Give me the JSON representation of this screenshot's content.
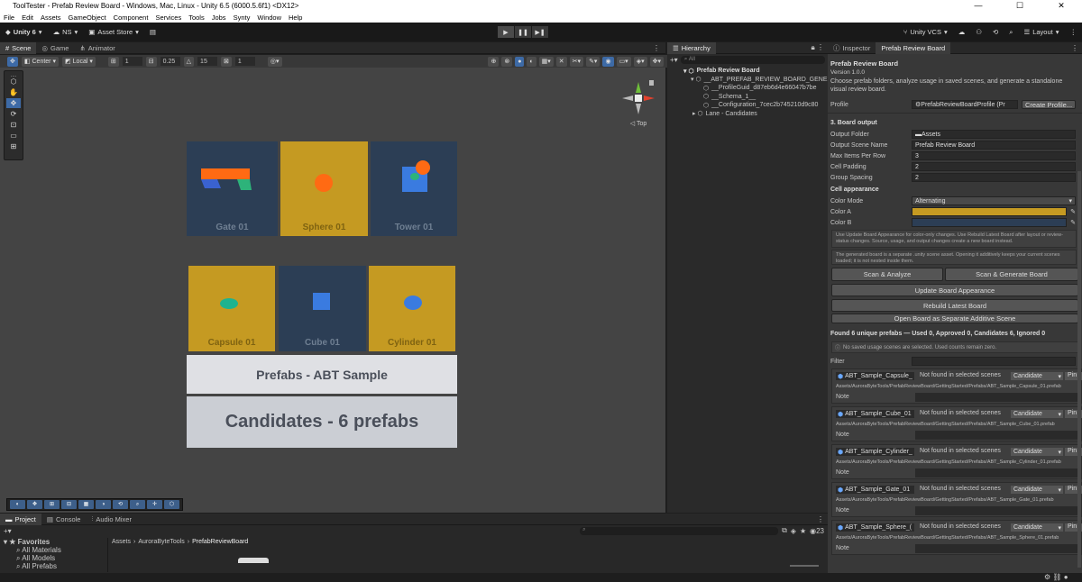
{
  "window": {
    "title": "ToolTester - Prefab Review Board - Windows, Mac, Linux - Unity 6.5 (6000.5.6f1) <DX12>"
  },
  "menu": [
    "File",
    "Edit",
    "Assets",
    "GameObject",
    "Component",
    "Services",
    "Tools",
    "Jobs",
    "Synty",
    "Window",
    "Help"
  ],
  "toolbar": {
    "account": "Unity 6",
    "ns": "NS",
    "asset_store": "Asset Store",
    "vcs": "Unity VCS",
    "layout": "Layout"
  },
  "scene_tabs": [
    {
      "label": "Scene"
    },
    {
      "label": "Game"
    },
    {
      "label": "Animator"
    }
  ],
  "scene_toolbar": {
    "pivot": "Center",
    "space": "Local",
    "snap1": "1",
    "snap2": "0.25",
    "snap3": "15",
    "snap4": "1"
  },
  "gizmo": {
    "view_label": "Top"
  },
  "board": {
    "row1": [
      {
        "label": "Gate 01"
      },
      {
        "label": "Sphere 01"
      },
      {
        "label": "Tower 01"
      }
    ],
    "row2": [
      {
        "label": "Capsule 01"
      },
      {
        "label": "Cube 01"
      },
      {
        "label": "Cylinder 01"
      }
    ],
    "lane_title": "Prefabs - ABT Sample",
    "lane_subtitle": "Candidates - 6 prefabs"
  },
  "hierarchy": {
    "tab": "Hierarchy",
    "search_placeholder": "All",
    "items": [
      "Prefab Review Board",
      "__ABT_PREFAB_REVIEW_BOARD_GENER",
      "__ProfileGuid_d87eb6d4e66047b7be",
      "__Schema_1__",
      "__Configuration_7cec2b745210d9c80",
      "Lane - Candidates"
    ]
  },
  "inspector": {
    "tabs": [
      "Inspector",
      "Prefab Review Board"
    ],
    "title": "Prefab Review Board",
    "version": "Version 1.0.0",
    "description": "Choose prefab folders, analyze usage in saved scenes, and generate a standalone visual review board.",
    "profile_label": "Profile",
    "profile_value": "PrefabReviewBoardProfile (Pr",
    "create_profile": "Create Profile...",
    "section_output": "3. Board output",
    "output_fields": [
      {
        "label": "Output Folder",
        "value": "Assets"
      },
      {
        "label": "Output Scene Name",
        "value": "Prefab Review Board"
      },
      {
        "label": "Max Items Per Row",
        "value": "3"
      },
      {
        "label": "Cell Padding",
        "value": "2"
      },
      {
        "label": "Group Spacing",
        "value": "2"
      }
    ],
    "section_cell": "Cell appearance",
    "color_mode_label": "Color Mode",
    "color_mode_value": "Alternating",
    "color_a_label": "Color A",
    "color_a": "#c59a22",
    "color_b_label": "Color B",
    "color_b": "#2c3e55",
    "help1": "Use Update Board Appearance for color-only changes. Use Rebuild Latest Board after layout or review-status changes. Source, usage, and output changes create a new board instead.",
    "help2": "The generated board is a separate .unity scene asset. Opening it additively keeps your current scenes loaded; it is not nested inside them.",
    "btn_scan": "Scan & Analyze",
    "btn_scan_gen": "Scan & Generate Board",
    "btn_update": "Update Board Appearance",
    "btn_rebuild": "Rebuild Latest Board",
    "btn_open": "Open Board as Separate Additive Scene",
    "summary": "Found 6 unique prefabs — Used 0, Approved 0, Candidates 6, Ignored 0",
    "info": "No saved usage scenes are selected. Used counts remain zero.",
    "filter_label": "Filter",
    "note_label": "Note",
    "status_text": "Not found in selected scenes",
    "pin_label": "Pin",
    "prefabs": [
      {
        "name": "ABT_Sample_Capsule_",
        "status": "Candidate",
        "path": "Assets/AuroraByteTools/PrefabReviewBoard/GettingStarted/Prefabs/ABT_Sample_Capsule_01.prefab"
      },
      {
        "name": "ABT_Sample_Cube_01",
        "status": "Candidate",
        "path": "Assets/AuroraByteTools/PrefabReviewBoard/GettingStarted/Prefabs/ABT_Sample_Cube_01.prefab"
      },
      {
        "name": "ABT_Sample_Cylinder_",
        "status": "Candidate",
        "path": "Assets/AuroraByteTools/PrefabReviewBoard/GettingStarted/Prefabs/ABT_Sample_Cylinder_01.prefab"
      },
      {
        "name": "ABT_Sample_Gate_01",
        "status": "Candidate",
        "path": "Assets/AuroraByteTools/PrefabReviewBoard/GettingStarted/Prefabs/ABT_Sample_Gate_01.prefab"
      },
      {
        "name": "ABT_Sample_Sphere_(",
        "status": "Candidate",
        "path": "Assets/AuroraByteTools/PrefabReviewBoard/GettingStarted/Prefabs/ABT_Sample_Sphere_01.prefab"
      }
    ]
  },
  "project": {
    "tabs": [
      "Project",
      "Console",
      "Audio Mixer"
    ],
    "favorites": "Favorites",
    "fav_items": [
      "All Materials",
      "All Models",
      "All Prefabs"
    ],
    "breadcrumb": [
      "Assets",
      "AuroraByteTools",
      "PrefabReviewBoard"
    ],
    "count": "23"
  }
}
